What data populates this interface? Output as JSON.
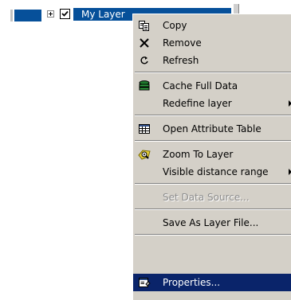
{
  "layer": {
    "name": "My Layer",
    "checked": true
  },
  "menu": {
    "copy": "Copy",
    "remove": "Remove",
    "refresh": "Refresh",
    "cache_full_data": "Cache Full Data",
    "redefine_layer": "Redefine layer",
    "open_attribute_table": "Open Attribute Table",
    "zoom_to_layer": "Zoom To Layer",
    "visible_distance_range": "Visible distance range",
    "set_data_source": "Set Data Source...",
    "save_as_layer_file": "Save As Layer File...",
    "properties": "Properties..."
  },
  "colors": {
    "selection": "#06509a",
    "menu_highlight": "#0a246a",
    "menu_background": "#d4d0c8",
    "disabled_text": "#8c8c8c"
  },
  "icons": {
    "copy": "copy-icon",
    "remove": "remove-x-icon",
    "refresh": "refresh-icon",
    "cache_full_data": "database-stack-icon",
    "open_attribute_table": "table-icon",
    "zoom_to_layer": "zoom-magnifier-icon",
    "properties": "properties-icon",
    "submenu": "chevron-right-icon"
  }
}
